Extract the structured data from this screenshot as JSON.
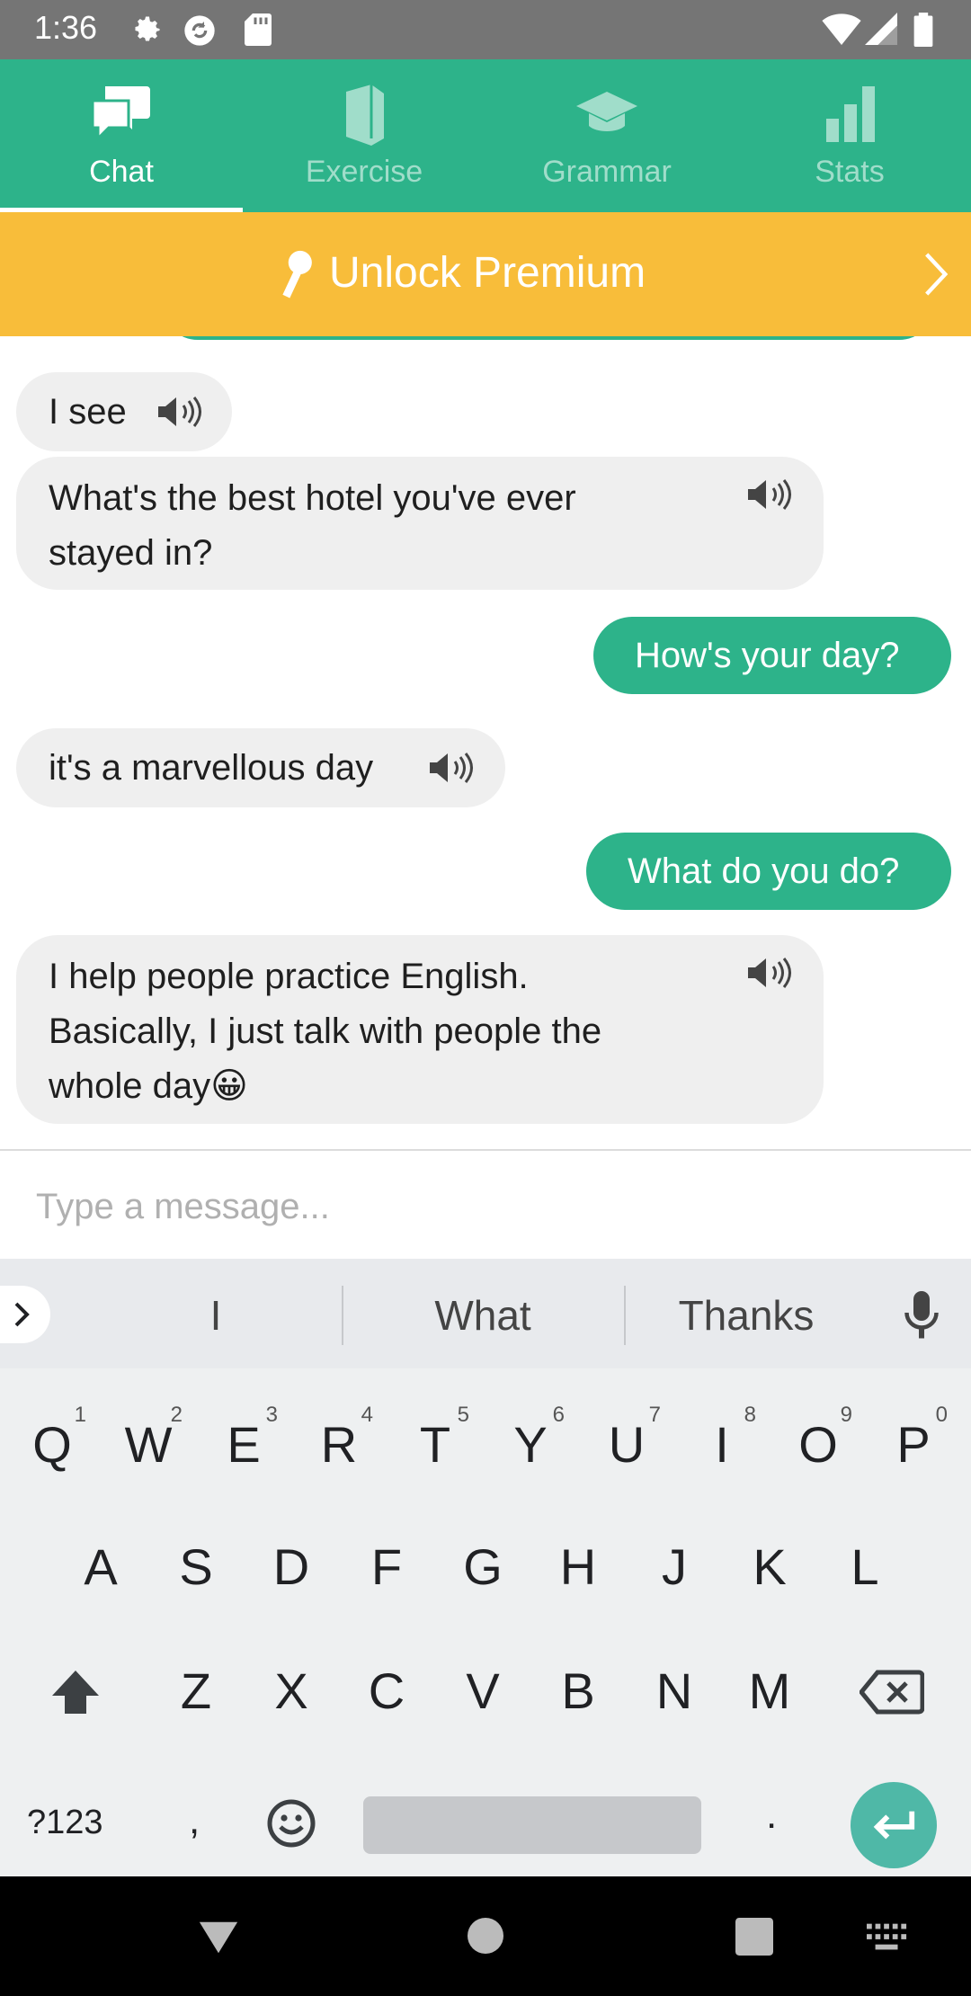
{
  "status_bar": {
    "time": "1:36"
  },
  "tabs": [
    {
      "label": "Chat",
      "active": true
    },
    {
      "label": "Exercise",
      "active": false
    },
    {
      "label": "Grammar",
      "active": false
    },
    {
      "label": "Stats",
      "active": false
    }
  ],
  "premium": {
    "label": "Unlock Premium"
  },
  "messages": [
    {
      "sender": "bot",
      "text": "I see"
    },
    {
      "sender": "bot",
      "line1": "What's the best hotel you've ever",
      "line2": "stayed in?"
    },
    {
      "sender": "user",
      "text": "How's your day?"
    },
    {
      "sender": "bot",
      "text": "it's a marvellous day"
    },
    {
      "sender": "user",
      "text": "What do you do?"
    },
    {
      "sender": "bot",
      "line1": "I help people practice English.",
      "line2": "Basically, I just talk with people the",
      "line3": "whole day",
      "emoji": "😀"
    }
  ],
  "input": {
    "placeholder": "Type a message..."
  },
  "keyboard": {
    "suggestions": [
      "I",
      "What",
      "Thanks"
    ],
    "row1": [
      {
        "k": "Q",
        "n": "1"
      },
      {
        "k": "W",
        "n": "2"
      },
      {
        "k": "E",
        "n": "3"
      },
      {
        "k": "R",
        "n": "4"
      },
      {
        "k": "T",
        "n": "5"
      },
      {
        "k": "Y",
        "n": "6"
      },
      {
        "k": "U",
        "n": "7"
      },
      {
        "k": "I",
        "n": "8"
      },
      {
        "k": "O",
        "n": "9"
      },
      {
        "k": "P",
        "n": "0"
      }
    ],
    "row2": [
      "A",
      "S",
      "D",
      "F",
      "G",
      "H",
      "J",
      "K",
      "L"
    ],
    "row3": [
      "Z",
      "X",
      "C",
      "V",
      "B",
      "N",
      "M"
    ],
    "symbols_label": "?123",
    "comma": ",",
    "period": "."
  },
  "colors": {
    "accent": "#2db38a",
    "premium": "#f8bd3a",
    "bubble_bot": "#efefef"
  }
}
